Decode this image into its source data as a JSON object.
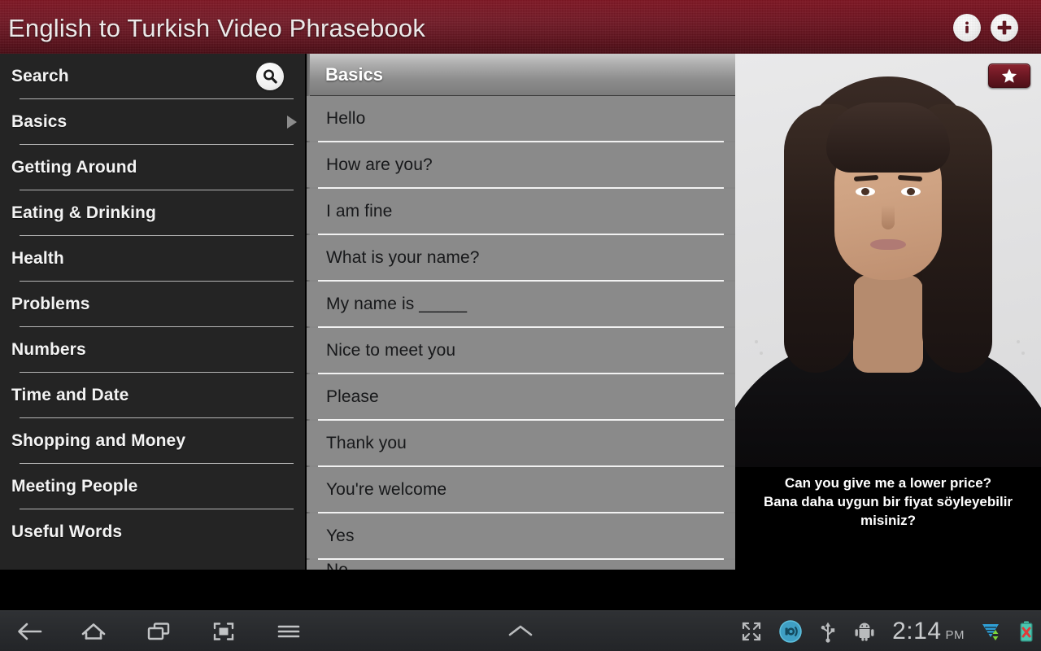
{
  "header": {
    "title": "English to Turkish Video Phrasebook",
    "info_icon": "info-icon",
    "add_icon": "plus-icon",
    "brand_color": "#701320"
  },
  "sidebar": {
    "search": {
      "label": "Search",
      "icon": "search-icon"
    },
    "items": [
      {
        "label": "Basics",
        "selected": true,
        "has_caret": true
      },
      {
        "label": "Getting Around",
        "selected": false,
        "has_caret": false
      },
      {
        "label": "Eating & Drinking",
        "selected": false,
        "has_caret": false
      },
      {
        "label": "Health",
        "selected": false,
        "has_caret": false
      },
      {
        "label": "Problems",
        "selected": false,
        "has_caret": false
      },
      {
        "label": "Numbers",
        "selected": false,
        "has_caret": false
      },
      {
        "label": "Time and Date",
        "selected": false,
        "has_caret": false
      },
      {
        "label": "Shopping and Money",
        "selected": false,
        "has_caret": false
      },
      {
        "label": "Meeting People",
        "selected": false,
        "has_caret": false
      },
      {
        "label": "Useful Words",
        "selected": false,
        "has_caret": false
      }
    ]
  },
  "list": {
    "header_title": "Basics",
    "phrases": [
      "Hello",
      "How are you?",
      "I am fine",
      "What is your name?",
      "My name is _____",
      "Nice to meet you",
      "Please",
      "Thank you",
      "You're welcome",
      "Yes"
    ],
    "partial_phrase": "No"
  },
  "video": {
    "favorite_icon": "star-icon",
    "caption_english": "Can you give me a lower price?",
    "caption_turkish": "Bana daha uygun bir fiyat söyleyebilir misiniz?"
  },
  "navbar": {
    "back_icon": "back-arrow-icon",
    "home_icon": "home-icon",
    "recents_icon": "recent-apps-icon",
    "screenshot_icon": "screenshot-icon",
    "menu_icon": "menu-icon",
    "expand_icon": "chevron-up-icon",
    "fullscreen_icon": "fullscreen-icon",
    "sound_icon": "sound-icon",
    "usb_icon": "usb-icon",
    "android_icon": "android-icon",
    "time": "2:14",
    "ampm": "PM",
    "wifi_icon": "wifi-icon",
    "battery_icon": "battery-error-icon"
  }
}
